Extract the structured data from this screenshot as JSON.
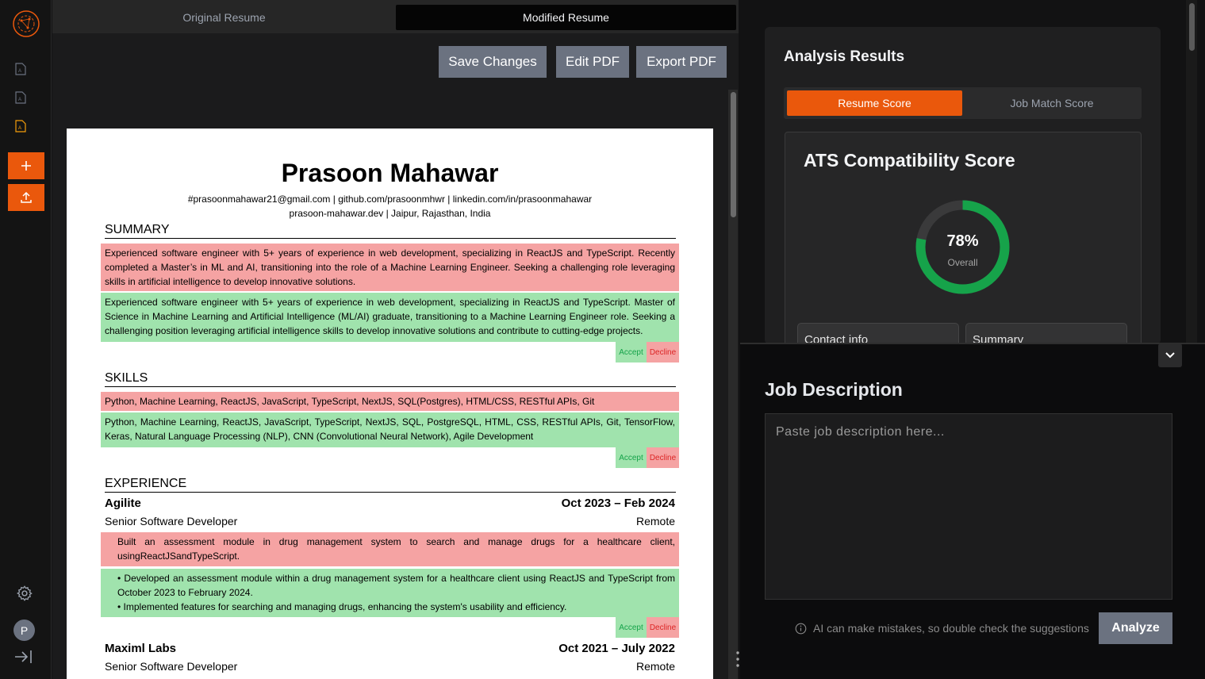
{
  "tabs": {
    "original": "Original Resume",
    "modified": "Modified Resume"
  },
  "toolbar": {
    "save": "Save Changes",
    "edit": "Edit PDF",
    "export": "Export PDF"
  },
  "sidebar": {
    "avatar_letter": "P",
    "icons": [
      "logo-icon",
      "file-icon",
      "file-icon",
      "file-icon-active",
      "plus-icon",
      "upload-icon",
      "gear-icon",
      "collapse-icon"
    ]
  },
  "resume": {
    "name": "Prasoon Mahawar",
    "contact_line1": "#prasoonmahawar21@gmail.com | github.com/prasoonmhwr | linkedin.com/in/prasoonmahawar",
    "contact_line2": "prasoon-mahawar.dev | Jaipur, Rajasthan, India",
    "summary_heading": "SUMMARY",
    "summary_old": "Experienced software engineer with 5+ years of experience in web development, specializing in ReactJS and TypeScript. Recently completed a Master’s in ML and AI, transitioning into the role of a Machine Learning Engineer. Seeking a challenging role leveraging skills in artificial intelligence to develop innovative solutions.",
    "summary_new": "Experienced software engineer with 5+ years of experience in web development, specializing in ReactJS and TypeScript. Master of Science in Machine Learning and Artificial Intelligence (ML/AI) graduate, transitioning to a Machine Learning Engineer role. Seeking a challenging position leveraging artificial intelligence skills to develop innovative solutions and contribute to cutting-edge projects.",
    "skills_heading": "SKILLS",
    "skills_old": "Python, Machine Learning, ReactJS, JavaScript, TypeScript, NextJS, SQL(Postgres), HTML/CSS, RESTful APIs, Git",
    "skills_new": "Python, Machine Learning, ReactJS, JavaScript, TypeScript, NextJS, SQL, PostgreSQL, HTML, CSS, RESTful APIs, Git, TensorFlow, Keras, Natural Language Processing (NLP), CNN (Convolutional Neural Network), Agile Development",
    "experience_heading": "EXPERIENCE",
    "job1": {
      "company": "Agilite",
      "dates": "Oct 2023 – Feb 2024",
      "role": "Senior Software Developer",
      "location": "Remote"
    },
    "job1_old": "Built an assessment module in drug management system to search and manage drugs for a healthcare client, usingReactJSandTypeScript.",
    "job1_new_1": "• Developed an assessment module within a drug management system for a healthcare client using ReactJS and TypeScript from October 2023 to February 2024.",
    "job1_new_2": "• Implemented features for searching and managing drugs, enhancing the system's usability and efficiency.",
    "job2": {
      "company": "Maximl Labs",
      "dates": "Oct 2021 – July 2022",
      "role": "Senior Software Developer",
      "location": "Remote"
    },
    "accept": "Accept",
    "decline": "Decline"
  },
  "analysis": {
    "title": "Analysis Results",
    "tab_resume": "Resume Score",
    "tab_job": "Job Match Score",
    "ats_title": "ATS Compatibility Score",
    "score": 78,
    "score_text": "78%",
    "score_label": "Overall",
    "mini_cards": [
      "Contact info",
      "Summary"
    ],
    "accent": "#ea580c",
    "score_color": "#16a34a"
  },
  "job": {
    "title": "Job Description",
    "placeholder": "Paste job description here...",
    "disclaimer": "AI can make mistakes, so double check the suggestions",
    "analyze": "Analyze"
  }
}
